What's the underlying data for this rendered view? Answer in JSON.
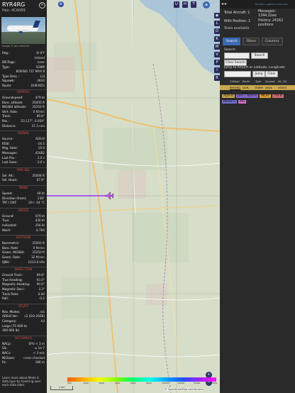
{
  "aircraft": {
    "registration_title": "RYR4RG",
    "hex_label": "Hex:",
    "hex": "4CA089",
    "photo_credit": "Image © Jan Lesnicka",
    "fields": [
      {
        "k": "Reg.:",
        "v": "EI-IFY"
      },
      {
        "k": "",
        "v": "Ireland"
      },
      {
        "k": "DB flags:",
        "v": "none"
      },
      {
        "k": "Type:",
        "v": "B38M"
      },
      {
        "k": "",
        "v": "BOEING 737 MAX 8"
      },
      {
        "k": "Type Desc.:",
        "v": "L2J"
      },
      {
        "k": "Squawk:",
        "v": "4644"
      },
      {
        "k": "Route:",
        "v": "DUB-BZG"
      }
    ]
  },
  "sections": {
    "spatial": {
      "title": "SPATIAL",
      "rows": [
        {
          "k": "Groundspeed:",
          "v": "479 kt"
        },
        {
          "k": "Baro. altitude:",
          "v": "35000 ft"
        },
        {
          "k": "WGS84 altitude:",
          "v": "35250 ft"
        },
        {
          "k": "Vert. Rate:",
          "v": "0 ft/min"
        },
        {
          "k": "Track:",
          "v": "89.8°"
        },
        {
          "k": "Pos.:",
          "v": "53.127°, 6.959°"
        },
        {
          "k": "Distance:",
          "v": "37.3 nmi"
        }
      ]
    },
    "signal": {
      "title": "SIGNAL",
      "rows": [
        {
          "k": "Source:",
          "v": "ADS-B"
        },
        {
          "k": "RSSI:",
          "v": "-16.5"
        },
        {
          "k": "Msg. Rate:",
          "v": "19.0"
        },
        {
          "k": "Messages:",
          "v": "41682"
        },
        {
          "k": "Last Pos.:",
          "v": "2.0 s"
        },
        {
          "k": "Last Seen:",
          "v": "0.0 s"
        }
      ]
    },
    "fmssel": {
      "title": "FMS SEL",
      "rows": [
        {
          "k": "Sel. Alt.:",
          "v": "35008 ft"
        },
        {
          "k": "Sel. Head.:",
          "v": "87.9°"
        }
      ]
    },
    "wind": {
      "title": "WIND",
      "rows": [
        {
          "k": "Speed:",
          "v": "49 kt"
        },
        {
          "k": "Direction (from):",
          "v": "238°"
        },
        {
          "k": "TAT / OAT:",
          "v": "-29 / -54 °C"
        }
      ]
    },
    "speed": {
      "title": "SPEED",
      "rows": [
        {
          "k": "Ground:",
          "v": "479 kt"
        },
        {
          "k": "True:",
          "v": "436 kt"
        },
        {
          "k": "Indicated:",
          "v": "256 kt"
        },
        {
          "k": "Mach:",
          "v": "0.760"
        }
      ]
    },
    "altitude": {
      "title": "ALTITUDE",
      "rows": [
        {
          "k": "Barometric:",
          "v": "35000 ft"
        },
        {
          "k": "Baro. Rate:",
          "v": "0 ft/min"
        },
        {
          "k": "Geom. WGS84:",
          "v": "35250 ft"
        },
        {
          "k": "Geom. Rate:",
          "v": "32 ft/min"
        },
        {
          "k": "QNH:",
          "v": "1013.6 hPa"
        }
      ]
    },
    "direction": {
      "title": "DIRECTION",
      "rows": [
        {
          "k": "Ground Track:",
          "v": "89.8°"
        },
        {
          "k": "True Heading:",
          "v": "93.4°"
        },
        {
          "k": "Magnetic Heading:",
          "v": "90.0°"
        },
        {
          "k": "Magnetic Decl.:",
          "v": "3.3°"
        },
        {
          "k": "Track Rate:",
          "v": "0.00"
        },
        {
          "k": "Roll:",
          "v": "-0.2"
        }
      ]
    },
    "stuff": {
      "title": "STUFF",
      "rows": [
        {
          "k": "Nav. Modes:",
          "v": "n/a"
        },
        {
          "k": "ADS-B Ver.:",
          "v": "v2 (DO-260B)"
        },
        {
          "k": "Category:",
          "v": "A3"
        },
        {
          "k": "Large (75 000 to",
          "v": ""
        },
        {
          "k": "300 000 lb)",
          "v": ""
        }
      ]
    },
    "accuracy": {
      "title": "ACCURACY",
      "rows": [
        {
          "k": "NACp:",
          "v": "EPU < 3 m"
        },
        {
          "k": "SIL:",
          "v": "≤ 1e-7"
        },
        {
          "k": "NACv:",
          "v": "< 3 m/s"
        },
        {
          "k": "NICbaro:",
          "v": "cross-checked"
        },
        {
          "k": "Rc:",
          "v": "186 m"
        }
      ]
    }
  },
  "footer_text": "Learn more about Mode S data type by hovering over each data label.",
  "map_buttons": {
    "top": [
      "U",
      "H",
      "T"
    ],
    "layers_icon": "layers-icon",
    "side": [
      "◉",
      "L",
      "O",
      "K",
      "M",
      "V",
      "P",
      "I",
      "R"
    ],
    "zoom_in": "+",
    "zoom_out": "−",
    "attribution": "© OpenStreetMap contributors",
    "scale_label": "2 NM"
  },
  "altitude_scale_labels": [
    "500",
    "1000",
    "2000",
    "4000",
    "6000",
    "8000",
    "10000",
    "20000",
    "30000",
    "40000+"
  ],
  "sidebar": {
    "version": "tar1090 on github (3.14.1751)",
    "total_aircraft_label": "Total Aircraft:",
    "total_aircraft": "1",
    "with_position_label": "With Position:",
    "with_position": "1",
    "messages_label": "Messages:",
    "messages": "1344.2/sec",
    "history_label": "History:",
    "history": "24162 positions",
    "stats_label": "Stats available",
    "tabs": [
      "Search",
      "Filters",
      "Columns"
    ],
    "search_label": "Search:",
    "search_button": "Search",
    "clear_search": "Clear Search",
    "jump_label": "Jump to Airport or Latitude, Longitude:",
    "jump_button": "Jump",
    "clear_button": "Clear",
    "table_headers": [
      "",
      "Callsign",
      "Route",
      "Type",
      "Squawk",
      "Alt. (ft)"
    ],
    "table_row": [
      "",
      "RYR4RG",
      "DUB-BZG",
      "B38M",
      "4644",
      "35000"
    ],
    "badges": [
      {
        "label": "ADS-B",
        "color": "#c9a74f"
      },
      {
        "label": "UAT / ADS-R",
        "color": "#8a6bd0"
      },
      {
        "label": "MLAT",
        "color": "#e0a030"
      },
      {
        "label": "TIS-B",
        "color": "#d07070"
      },
      {
        "label": "Mode-S",
        "color": "#7070d0"
      },
      {
        "label": "AIS",
        "color": "#d070d0"
      }
    ]
  }
}
